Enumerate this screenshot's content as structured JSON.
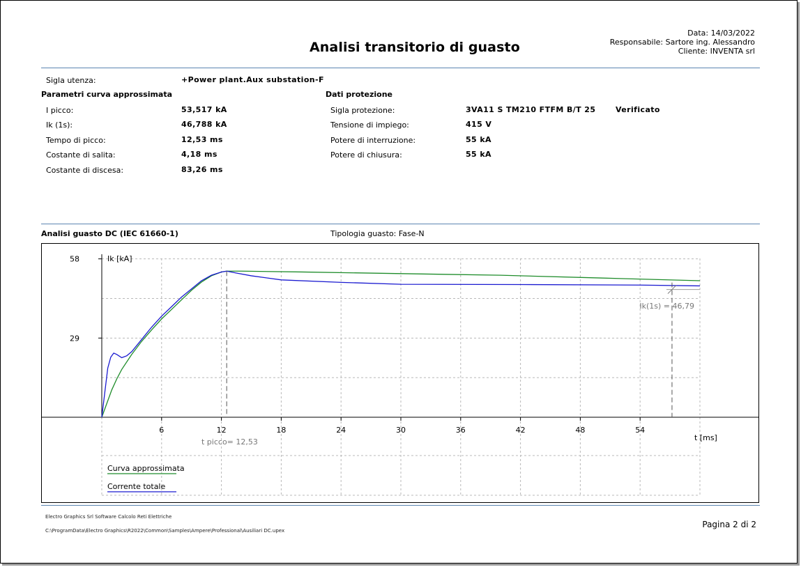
{
  "header": {
    "title": "Analisi transitorio di guasto",
    "date": "Data:  14/03/2022",
    "responsible": "Responsabile: Sartore ing. Alessandro",
    "client": "Cliente: INVENTA srl"
  },
  "utenza": {
    "label": "Sigla utenza:",
    "value": "+Power plant.Aux substation-F"
  },
  "curve_params": {
    "heading": "Parametri curva approssimata",
    "rows": [
      {
        "label": "I picco:",
        "value": "53,517 kA"
      },
      {
        "label": "Ik (1s):",
        "value": "46,788 kA"
      },
      {
        "label": "Tempo di picco:",
        "value": "12,53 ms"
      },
      {
        "label": "Costante di salita:",
        "value": "4,18 ms"
      },
      {
        "label": "Costante di discesa:",
        "value": "83,26 ms"
      }
    ]
  },
  "protection": {
    "heading": "Dati protezione",
    "status": "Verificato",
    "rows": [
      {
        "label": "Sigla protezione:",
        "value": "3VA11 S TM210 FTFM B/T 25"
      },
      {
        "label": "Tensione di impiego:",
        "value": "415 V"
      },
      {
        "label": "Potere di interruzione:",
        "value": "55 kA"
      },
      {
        "label": "Potere di chiusura:",
        "value": "55 kA"
      }
    ]
  },
  "analysis": {
    "title": "Analisi guasto DC (IEC 61660-1)",
    "fault_type": "Tipologia guasto: Fase-N"
  },
  "chart_data": {
    "type": "line",
    "ylabel": "Ik [kA]",
    "xlabel": "t [ms]",
    "ylim": [
      0,
      58
    ],
    "xlim": [
      0,
      60
    ],
    "y_ticks": [
      "58",
      "29"
    ],
    "x_ticks": [
      "6",
      "12",
      "18",
      "24",
      "30",
      "36",
      "42",
      "48",
      "54"
    ],
    "annotations": {
      "t_peak": "t picco= 12,53",
      "ik1s": "Ik(1s) = 46,79"
    },
    "series": [
      {
        "name": "Curva approssimata",
        "color": "#1e8c2a",
        "points": [
          [
            0,
            0
          ],
          [
            0.5,
            5
          ],
          [
            1,
            10
          ],
          [
            1.5,
            14
          ],
          [
            2,
            17.5
          ],
          [
            3,
            23
          ],
          [
            4,
            27.8
          ],
          [
            5,
            32
          ],
          [
            6,
            36
          ],
          [
            7,
            39.5
          ],
          [
            8,
            43
          ],
          [
            9,
            46.5
          ],
          [
            10,
            49.5
          ],
          [
            11,
            51.8
          ],
          [
            12,
            53.2
          ],
          [
            12.53,
            53.5
          ],
          [
            14,
            53.5
          ],
          [
            20,
            53.2
          ],
          [
            30,
            52.6
          ],
          [
            40,
            52
          ],
          [
            50,
            51
          ],
          [
            60,
            50
          ]
        ]
      },
      {
        "name": "Corrente totale",
        "color": "#1a1ad0",
        "points": [
          [
            0,
            0
          ],
          [
            0.3,
            9
          ],
          [
            0.6,
            18
          ],
          [
            0.9,
            22
          ],
          [
            1.2,
            23.5
          ],
          [
            1.5,
            23
          ],
          [
            2,
            21.8
          ],
          [
            2.5,
            22.5
          ],
          [
            3,
            24
          ],
          [
            4,
            28.5
          ],
          [
            5,
            33
          ],
          [
            6,
            37
          ],
          [
            7,
            40.5
          ],
          [
            8,
            44
          ],
          [
            9,
            47
          ],
          [
            10,
            50
          ],
          [
            11,
            52
          ],
          [
            12,
            53.2
          ],
          [
            12.53,
            53.5
          ],
          [
            13.5,
            52.8
          ],
          [
            15,
            51.8
          ],
          [
            18,
            50.3
          ],
          [
            24,
            49.4
          ],
          [
            30,
            48.7
          ],
          [
            42,
            48.6
          ],
          [
            54,
            48.4
          ],
          [
            60,
            48.1
          ]
        ]
      }
    ]
  },
  "footer": {
    "company": "Electro Graphics Srl  Software Calcolo Reti Elettriche",
    "path": "C:\\ProgramData\\Electro Graphics\\R2022\\Common\\Samples\\Ampere\\Professional\\Ausiliari DC.upex",
    "page": "Pagina 2 di 2"
  }
}
